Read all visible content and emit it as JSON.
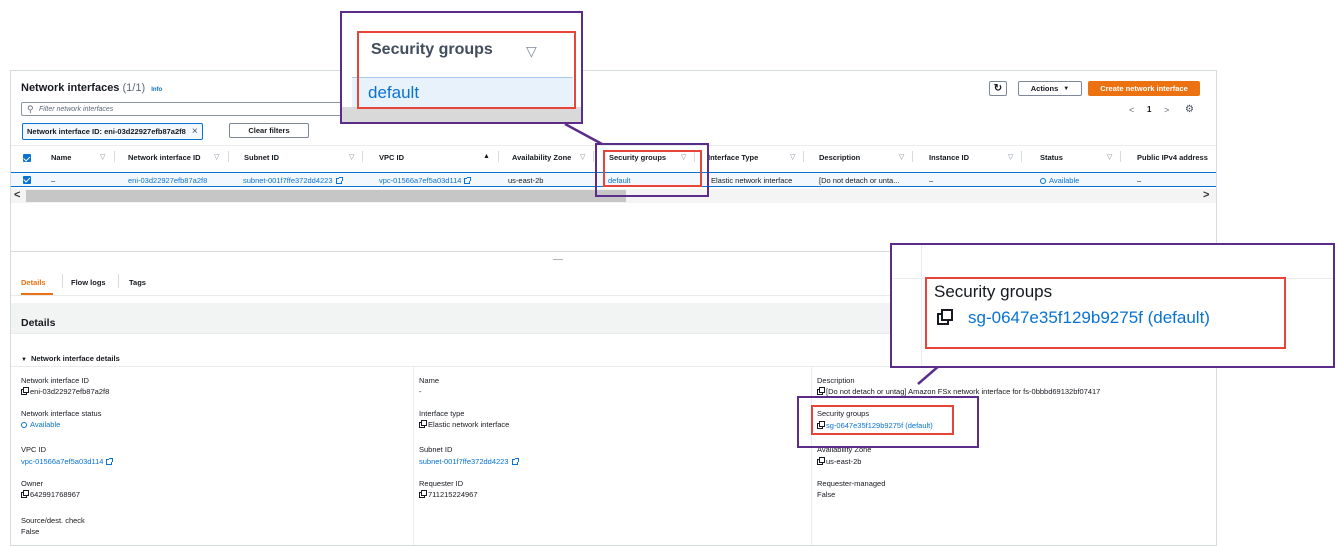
{
  "header": {
    "title": "Network interfaces",
    "count": "(1/1)",
    "info": "Info",
    "search_placeholder": "Filter network interfaces",
    "filter_token": "Network interface ID: eni-03d22927efb87a2f8",
    "clear_filters": "Clear filters",
    "actions": "Actions",
    "create": "Create network interface",
    "page": "1"
  },
  "table": {
    "columns": [
      "Name",
      "Network interface ID",
      "Subnet ID",
      "VPC ID",
      "Availability Zone",
      "Security groups",
      "Interface Type",
      "Description",
      "Instance ID",
      "Status",
      "Public IPv4 address"
    ],
    "row": {
      "name": "–",
      "eni": "eni-03d22927efb87a2f8",
      "subnet": "subnet-001f7ffe372dd4223",
      "vpc": "vpc-01566a7ef5a03d114",
      "az": "us-east-2b",
      "sg": "default",
      "type": "Elastic network interface",
      "description": "[Do not detach or unta...",
      "instance": "–",
      "status": "Available",
      "public_ip": "–"
    }
  },
  "tabs": [
    "Details",
    "Flow logs",
    "Tags"
  ],
  "details": {
    "title": "Details",
    "section": "Network interface details",
    "fields": {
      "eni_label": "Network interface ID",
      "eni_value": "eni-03d22927efb87a2f8",
      "name_label": "Name",
      "name_value": "-",
      "desc_label": "Description",
      "desc_value": "[Do not detach or untag] Amazon FSx network interface for fs-0bbbd69132bf07417",
      "status_label": "Network interface status",
      "status_value": "Available",
      "type_label": "Interface type",
      "type_value": "Elastic network interface",
      "sg_label": "Security groups",
      "sg_value": "sg-0647e35f129b9275f (default)",
      "vpc_label": "VPC ID",
      "vpc_value": "vpc-01566a7ef5a03d114",
      "subnet_label": "Subnet ID",
      "subnet_value": "subnet-001f7ffe372dd4223",
      "az_label": "Availability Zone",
      "az_value": "us-east-2b",
      "owner_label": "Owner",
      "owner_value": "642991768967",
      "requester_label": "Requester ID",
      "requester_value": "711215224967",
      "rm_label": "Requester-managed",
      "rm_value": "False",
      "sdc_label": "Source/dest. check",
      "sdc_value": "False"
    }
  },
  "callouts": {
    "top_header": "Security groups",
    "top_value": "default",
    "right_header": "Security groups",
    "right_value": "sg-0647e35f129b9275f (default)"
  },
  "colors": {
    "accent": "#0972d3",
    "orange": "#ec7211",
    "callout_border": "#5b2c8a",
    "highlight": "#e8443a"
  }
}
